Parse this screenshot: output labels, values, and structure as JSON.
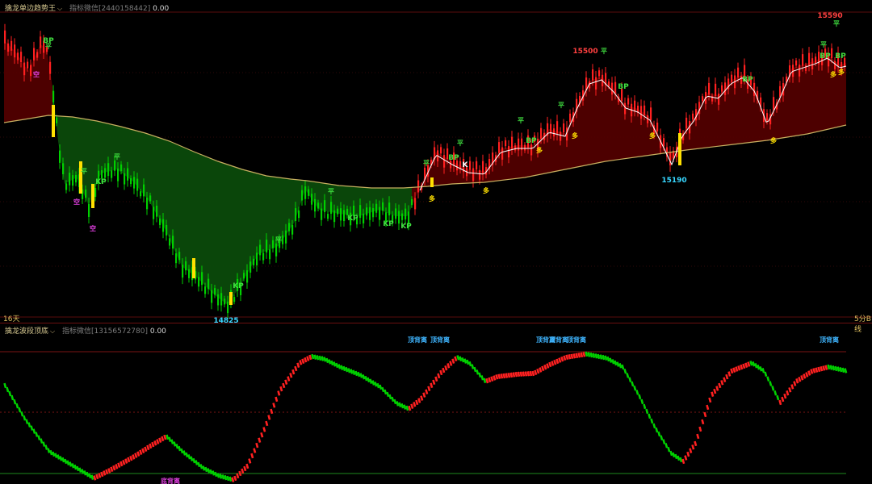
{
  "top_panel": {
    "title": "擒龙单边趋势王",
    "subtitle": "指标微信[2440158442]",
    "value": "0.00",
    "bottom_left": "16天",
    "bottom_right": "5分B线",
    "high_label": "15590",
    "mid_high_label": "15500",
    "low_label": "14825",
    "low2_label": "15190"
  },
  "bottom_panel": {
    "title": "擒龙波段顶底",
    "subtitle": "指标微信[13156572780]",
    "value": "0.00",
    "top_signal": "顶背离",
    "bottom_signal": "底背离"
  },
  "markers": {
    "bp": "BP",
    "kp": "KP",
    "k": "K",
    "ping": "平",
    "kong": "空",
    "duo": "多"
  },
  "colors": {
    "bear": "#00d000",
    "bull": "#ff2020",
    "cyan": "#37d6ff",
    "ma": "#c8b060",
    "ma_white": "#ffffff",
    "yellow": "#ffe000",
    "magenta": "#e040e0"
  }
}
